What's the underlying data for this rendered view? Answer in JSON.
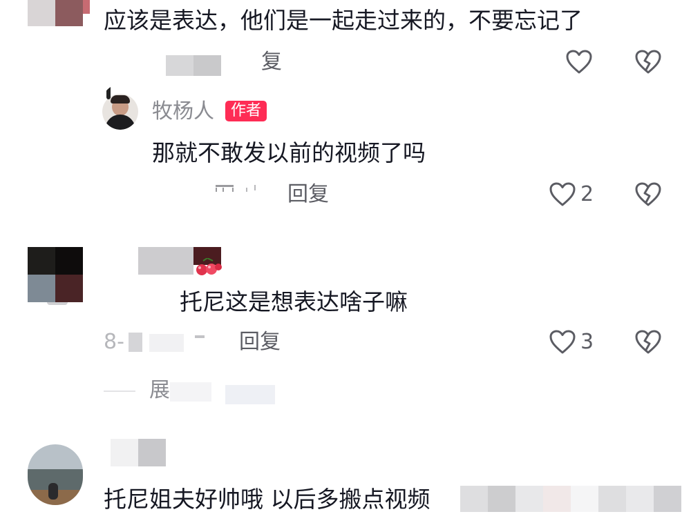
{
  "comments": [
    {
      "text": "应该是表达，他们是一起走过来的，不要忘记了",
      "reply_label": "复"
    },
    {
      "username": "牧杨人",
      "badge": "作者",
      "text": "那就不敢发以前的视频了吗",
      "reply_label": "回复",
      "like_count": "2"
    },
    {
      "text": "托尼这是想表达啥子嘛",
      "date_fragment": "8-",
      "reply_label": "回复",
      "like_count": "3",
      "expand_fragment": "展"
    },
    {
      "text": "托尼姐夫好帅哦  以后多搬点视频"
    }
  ],
  "icons": {
    "like": "heart-outline-icon",
    "dislike": "broken-heart-icon"
  },
  "colors": {
    "text": "#161823",
    "secondary": "#8a8b91",
    "author_badge": "#fe2c55"
  }
}
